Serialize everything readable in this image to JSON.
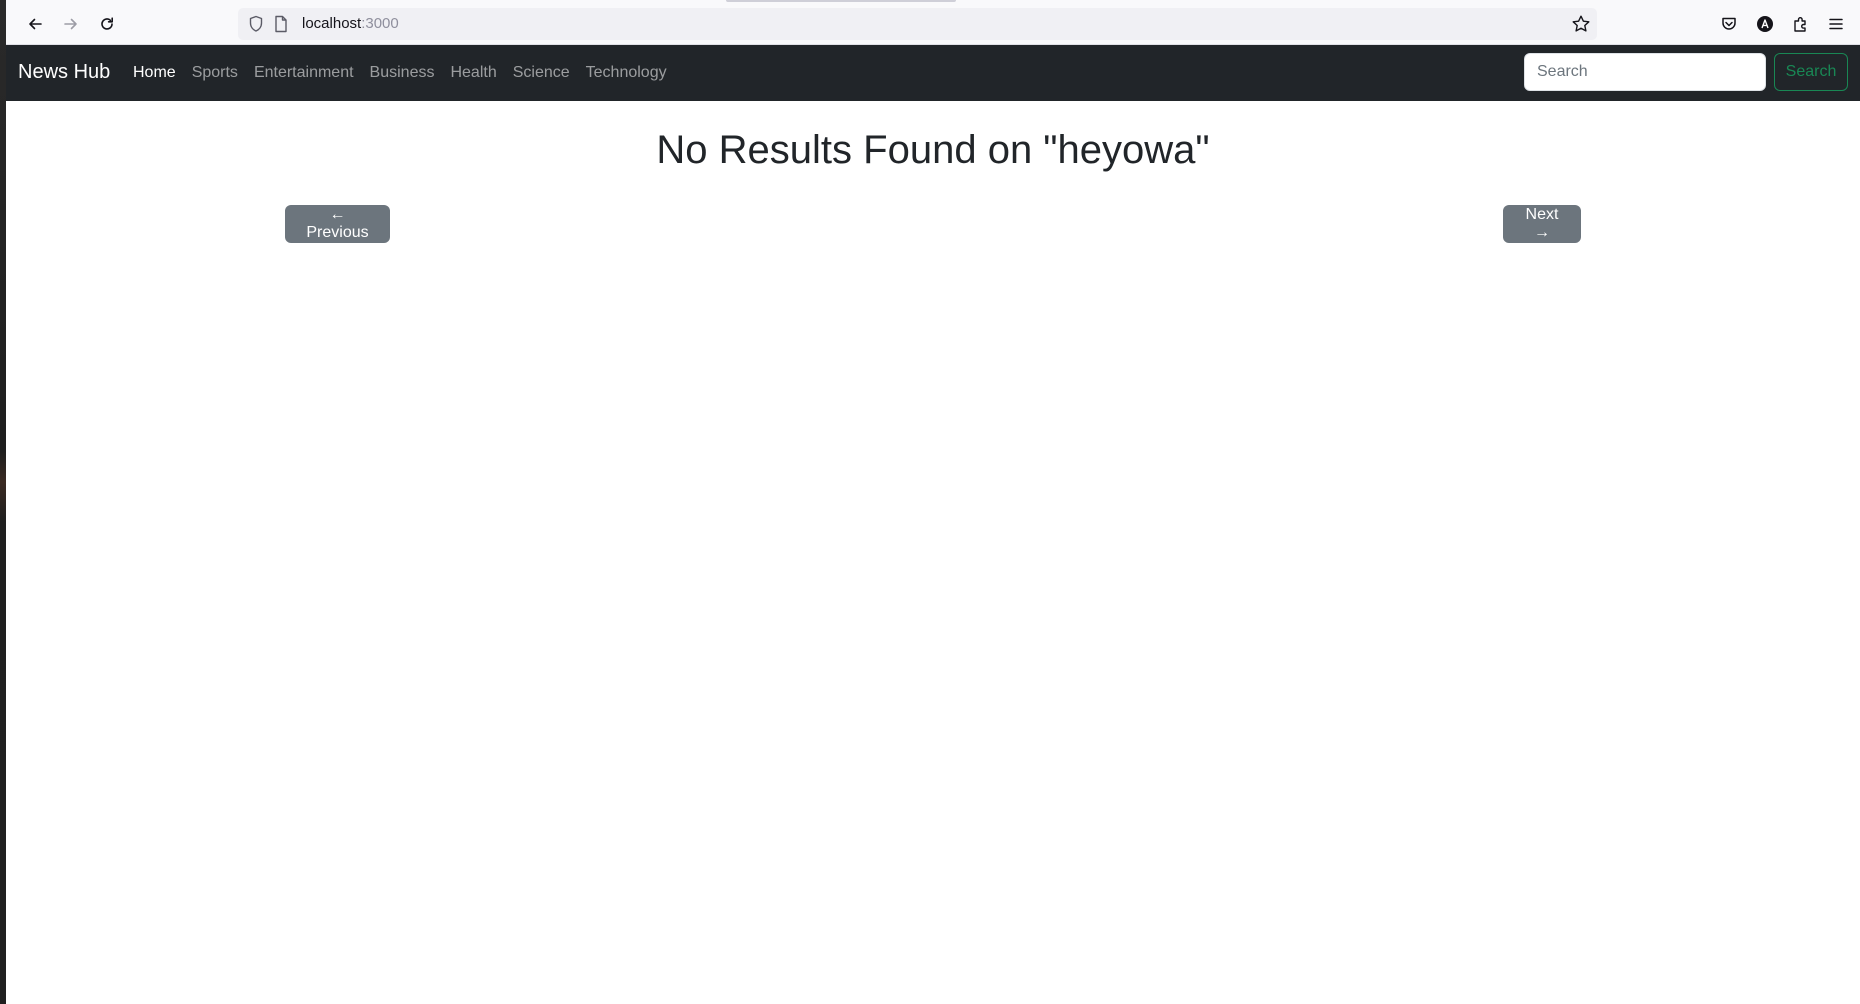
{
  "browser": {
    "url_host": "localhost",
    "url_port": ":3000"
  },
  "navbar": {
    "brand": "News Hub",
    "links": [
      {
        "label": "Home",
        "active": true
      },
      {
        "label": "Sports",
        "active": false
      },
      {
        "label": "Entertainment",
        "active": false
      },
      {
        "label": "Business",
        "active": false
      },
      {
        "label": "Health",
        "active": false
      },
      {
        "label": "Science",
        "active": false
      },
      {
        "label": "Technology",
        "active": false
      }
    ],
    "search": {
      "placeholder": "Search",
      "value": "",
      "button_label": "Search"
    }
  },
  "main": {
    "title": "No Results Found on \"heyowa\"",
    "prev_label": "← Previous",
    "next_label": "Next →"
  },
  "colors": {
    "navbar_bg": "#212529",
    "search_button": "#198754",
    "pager_button": "#6c757d"
  }
}
